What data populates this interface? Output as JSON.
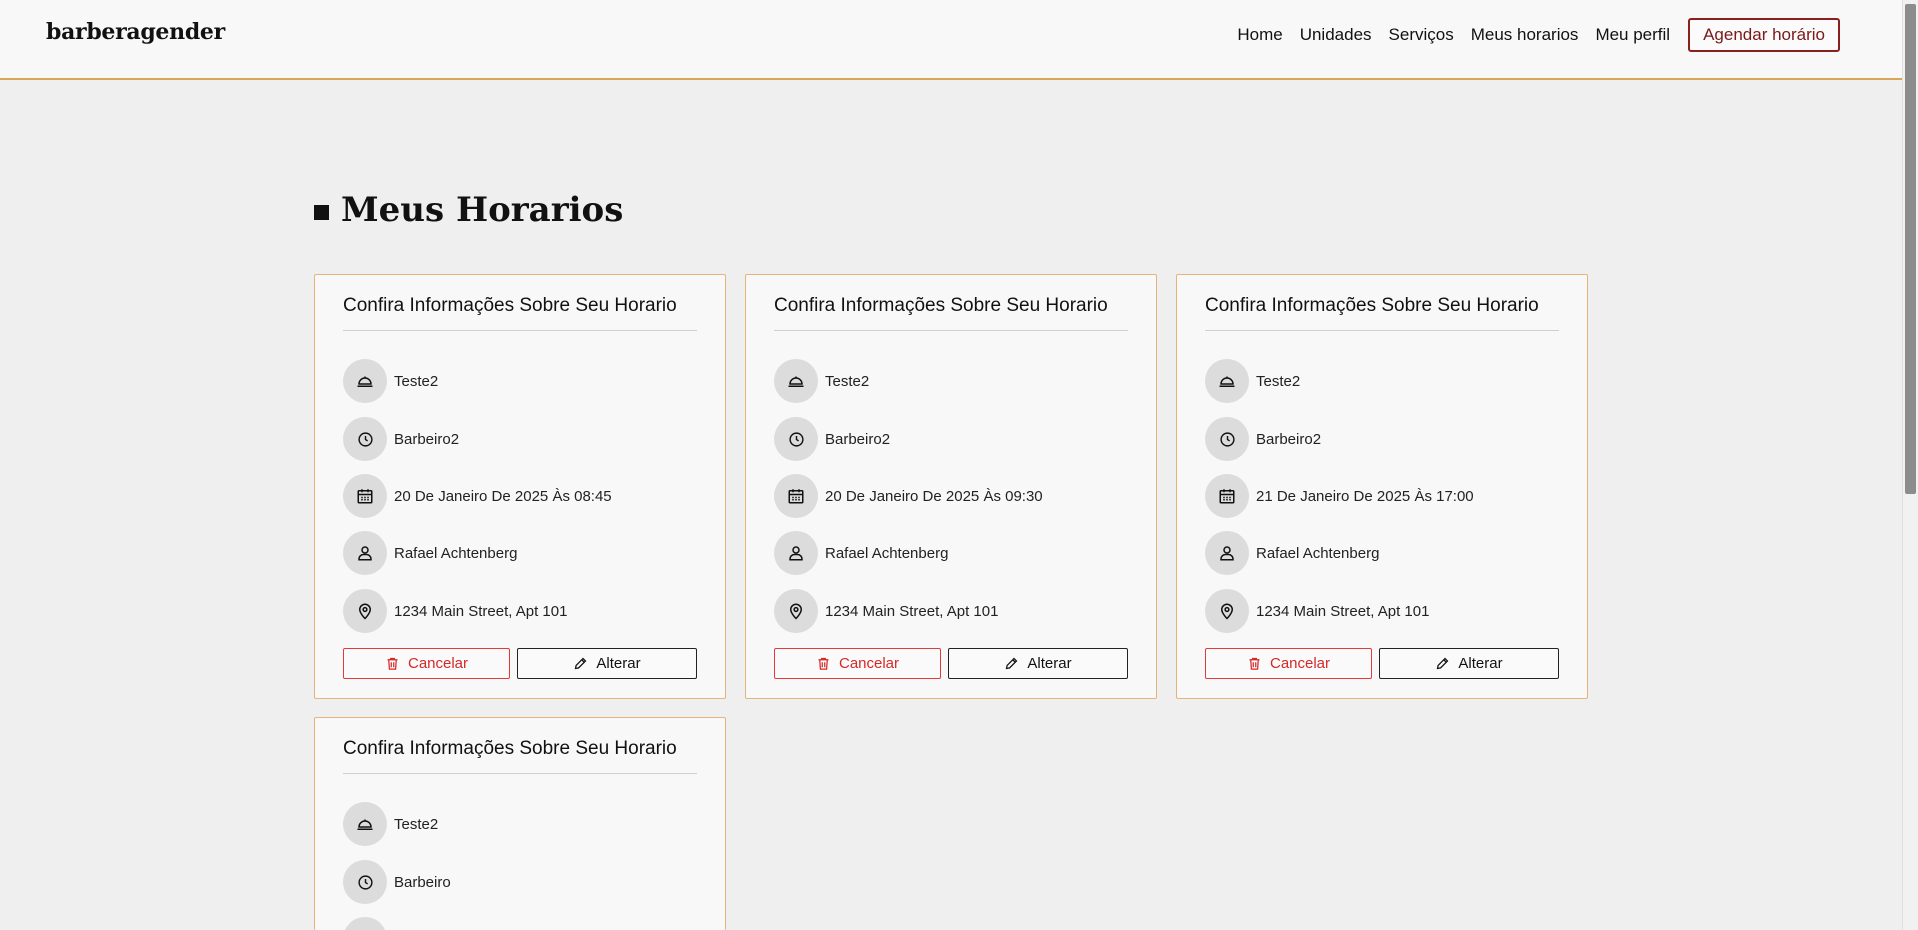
{
  "brand": "barberagender",
  "nav": {
    "links": [
      "Home",
      "Unidades",
      "Serviços",
      "Meus horarios",
      "Meu perfil"
    ],
    "cta": "Agendar horário"
  },
  "page": {
    "title": "Meus Horarios"
  },
  "colors": {
    "accent": "#d9a65a",
    "card_border": "#e4b47c",
    "cancel": "#d62828",
    "cta": "#7a1a1a"
  },
  "cards": [
    {
      "title": "Confira Informações Sobre Seu Horario",
      "service": "Teste2",
      "barber": "Barbeiro2",
      "datetime": "20 De Janeiro De 2025 Às 08:45",
      "client": "Rafael Achtenberg",
      "address": "1234 Main Street, Apt 101",
      "cancel_label": "Cancelar",
      "edit_label": "Alterar"
    },
    {
      "title": "Confira Informações Sobre Seu Horario",
      "service": "Teste2",
      "barber": "Barbeiro2",
      "datetime": "20 De Janeiro De 2025 Às 09:30",
      "client": "Rafael Achtenberg",
      "address": "1234 Main Street, Apt 101",
      "cancel_label": "Cancelar",
      "edit_label": "Alterar"
    },
    {
      "title": "Confira Informações Sobre Seu Horario",
      "service": "Teste2",
      "barber": "Barbeiro2",
      "datetime": "21 De Janeiro De 2025 Às 17:00",
      "client": "Rafael Achtenberg",
      "address": "1234 Main Street, Apt 101",
      "cancel_label": "Cancelar",
      "edit_label": "Alterar"
    },
    {
      "title": "Confira Informações Sobre Seu Horario",
      "service": "Teste2",
      "barber": "Barbeiro"
    }
  ],
  "icons": {
    "service": "cloche-icon",
    "barber": "clock-icon",
    "datetime": "calendar-icon",
    "client": "user-icon",
    "address": "map-pin-icon",
    "cancel": "trash-icon",
    "edit": "pencil-icon"
  }
}
